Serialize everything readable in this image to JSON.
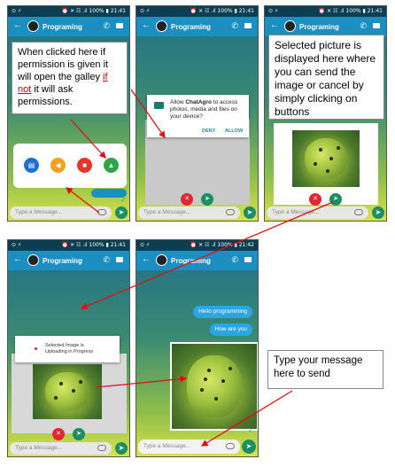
{
  "status": {
    "left": "⊙ ⚡",
    "right": "⏰ ✕ ☷ .ıl 100% ▮ 21:41",
    "right_last": "⏰ ✕ ☷ .ıl 100% ▮ 21:42"
  },
  "appbar": {
    "title": "Programing"
  },
  "input": {
    "placeholder": "Type a Message..."
  },
  "annotations": {
    "a1_pre": "When clicked here if permission is given it will open the galley ",
    "a1_link": "if not",
    "a1_post": " it will ask permissions.",
    "a2": "Selected picture is displayed here where you can send the image or cancel by simply clicking on buttons",
    "a3": "Type your message here to send"
  },
  "dialog": {
    "pre": "Allow ",
    "app": "ChatAgro",
    "post": " to access photos, media and files on your device?",
    "deny": "DENY",
    "allow": "ALLOW"
  },
  "upload": {
    "text": "Selected Image is Uploading in Progress"
  },
  "chat": {
    "msg1": "Hello programming",
    "msg2": "How are you"
  },
  "icons": [
    "back-arrow-icon",
    "phone-icon",
    "video-icon",
    "document-icon",
    "audio-icon",
    "camera-icon",
    "gallery-icon",
    "attach-icon",
    "send-icon",
    "cancel-icon",
    "folder-icon"
  ],
  "colors": {
    "appbar": "#1c8fc2",
    "send": "#1b8f63",
    "cancel": "#e3262f",
    "annotation_arrow": "#e01010"
  }
}
